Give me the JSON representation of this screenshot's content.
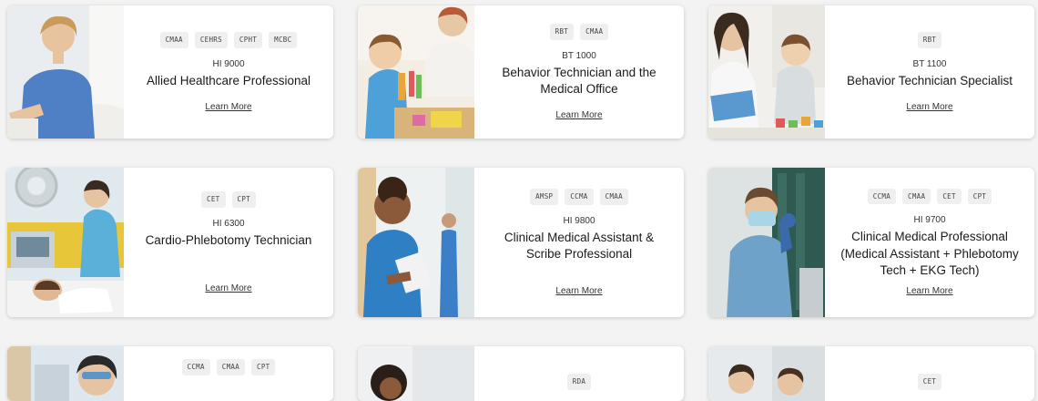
{
  "cards": [
    {
      "badges": [
        "CMAA",
        "CEHRS",
        "CPHT",
        "MCBC"
      ],
      "code": "HI 9000",
      "title": "Allied Healthcare Professional",
      "link": "Learn More"
    },
    {
      "badges": [
        "RBT",
        "CMAA"
      ],
      "code": "BT 1000",
      "title": "Behavior Technician and the Medical Office",
      "link": "Learn More"
    },
    {
      "badges": [
        "RBT"
      ],
      "code": "BT 1100",
      "title": "Behavior Technician Specialist",
      "link": "Learn More"
    },
    {
      "badges": [
        "CET",
        "CPT"
      ],
      "code": "HI 6300",
      "title": "Cardio-Phlebotomy Technician",
      "link": "Learn More"
    },
    {
      "badges": [
        "AMSP",
        "CCMA",
        "CMAA"
      ],
      "code": "HI 9800",
      "title": "Clinical Medical Assistant & Scribe Professional",
      "link": "Learn More"
    },
    {
      "badges": [
        "CCMA",
        "CMAA",
        "CET",
        "CPT"
      ],
      "code": "HI 9700",
      "title": "Clinical Medical Professional (Medical Assistant + Phlebotomy Tech + EKG Tech)",
      "link": "Learn More"
    },
    {
      "badges": [
        "CCMA",
        "CMAA",
        "CPT"
      ]
    },
    {
      "badges": [
        "RDA"
      ]
    },
    {
      "badges": [
        "CET"
      ]
    }
  ]
}
